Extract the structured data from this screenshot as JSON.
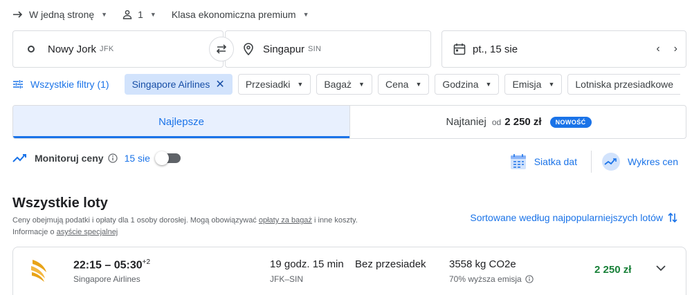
{
  "trip": {
    "type_label": "W jedną stronę",
    "passengers": "1",
    "cabin_class": "Klasa ekonomiczna premium"
  },
  "search": {
    "origin_city": "Nowy Jork",
    "origin_code": "JFK",
    "destination_city": "Singapur",
    "destination_code": "SIN",
    "date": "pt., 15 sie"
  },
  "filters": {
    "all_filters_label": "Wszystkie filtry (1)",
    "active_chip": "Singapore Airlines",
    "chips": [
      "Przesiadki",
      "Bagaż",
      "Cena",
      "Godzina",
      "Emisja",
      "Lotniska przesiadkowe"
    ]
  },
  "sort_tabs": {
    "best_label": "Najlepsze",
    "cheapest_label": "Najtaniej",
    "cheapest_from": "od",
    "cheapest_price": "2 250 zł",
    "new_badge": "NOWOŚĆ"
  },
  "price_tracking": {
    "label": "Monitoruj ceny",
    "date": "15 sie",
    "enabled": false
  },
  "tools": {
    "date_grid": "Siatka dat",
    "price_graph": "Wykres cen"
  },
  "results": {
    "heading": "Wszystkie loty",
    "note_1": "Ceny obejmują podatki i opłaty dla 1 osoby dorosłej. Mogą obowiązywać ",
    "note_link_1": "opłaty za bagaż",
    "note_2": " i inne koszty.",
    "note_3": "Informacje o ",
    "note_link_2": "asyście specjalnej",
    "sort_label": "Sortowane według najpopularniejszych lotów"
  },
  "flights": [
    {
      "departure": "22:15",
      "arrival": "05:30",
      "day_offset": "+2",
      "airline": "Singapore Airlines",
      "duration": "19 godz. 15 min",
      "route": "JFK–SIN",
      "stops": "Bez przesiadek",
      "co2": "3558 kg CO2e",
      "emission_note": "70% wyższa emisja",
      "price": "2 250 zł"
    }
  ],
  "colors": {
    "accent": "#1a73e8",
    "chip_selected_bg": "#d2e3fc",
    "price_green": "#188038",
    "airline_logo": "#e8a317"
  }
}
